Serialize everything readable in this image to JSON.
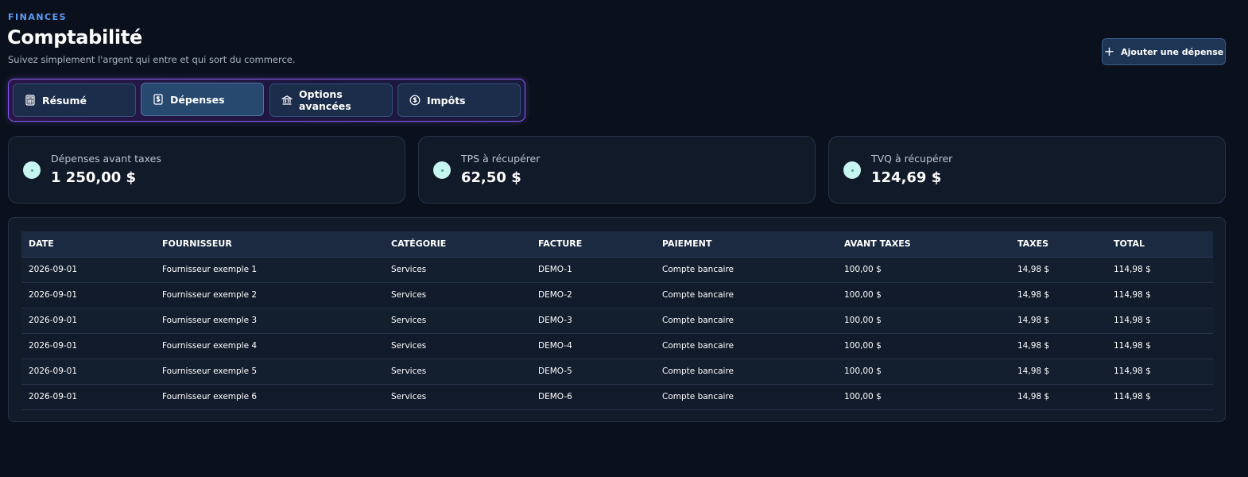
{
  "header": {
    "eyebrow": "FINANCES",
    "title": "Comptabilité",
    "subtitle": "Suivez simplement l'argent qui entre et qui sort du commerce.",
    "add_button": "Ajouter une dépense"
  },
  "tabs": [
    {
      "label": "Résumé",
      "icon": "calculator-icon"
    },
    {
      "label": "Dépenses",
      "icon": "receipt-dollar-icon",
      "active": true
    },
    {
      "label": "Options avancées",
      "icon": "bank-icon"
    },
    {
      "label": "Impôts",
      "icon": "dollar-circle-icon"
    }
  ],
  "summary": [
    {
      "label": "Dépenses avant taxes",
      "value": "1 250,00 $"
    },
    {
      "label": "TPS à récupérer",
      "value": "62,50 $"
    },
    {
      "label": "TVQ à récupérer",
      "value": "124,69 $"
    }
  ],
  "table": {
    "columns": [
      "DATE",
      "FOURNISSEUR",
      "CATÉGORIE",
      "FACTURE",
      "PAIEMENT",
      "AVANT TAXES",
      "TAXES",
      "TOTAL"
    ],
    "rows": [
      [
        "2026-09-01",
        "Fournisseur exemple 1",
        "Services",
        "DEMO-1",
        "Compte bancaire",
        "100,00 $",
        "14,98 $",
        "114,98 $"
      ],
      [
        "2026-09-01",
        "Fournisseur exemple 2",
        "Services",
        "DEMO-2",
        "Compte bancaire",
        "100,00 $",
        "14,98 $",
        "114,98 $"
      ],
      [
        "2026-09-01",
        "Fournisseur exemple 3",
        "Services",
        "DEMO-3",
        "Compte bancaire",
        "100,00 $",
        "14,98 $",
        "114,98 $"
      ],
      [
        "2026-09-01",
        "Fournisseur exemple 4",
        "Services",
        "DEMO-4",
        "Compte bancaire",
        "100,00 $",
        "14,98 $",
        "114,98 $"
      ],
      [
        "2026-09-01",
        "Fournisseur exemple 5",
        "Services",
        "DEMO-5",
        "Compte bancaire",
        "100,00 $",
        "14,98 $",
        "114,98 $"
      ],
      [
        "2026-09-01",
        "Fournisseur exemple 6",
        "Services",
        "DEMO-6",
        "Compte bancaire",
        "100,00 $",
        "14,98 $",
        "114,98 $"
      ]
    ]
  },
  "colors": {
    "accent": "#5b9cf5",
    "tab_border": "#8b5cf6",
    "background": "#0b111c"
  }
}
